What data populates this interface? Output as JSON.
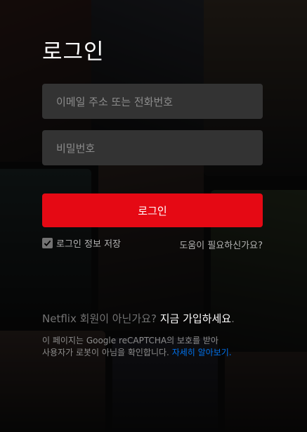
{
  "title": "로그인",
  "email_placeholder": "이메일 주소 또는 전화번호",
  "password_placeholder": "비밀번호",
  "login_button": "로그인",
  "remember_label": "로그인 정보 저장",
  "help_link": "도움이 필요하신가요?",
  "signup_prefix": "Netflix 회원이 아닌가요?",
  "signup_link": "지금 가입하세요",
  "signup_suffix": ".",
  "captcha_line1": "이 페이지는 Google reCAPTCHA의 보호를 받아",
  "captcha_line2": "사용자가 로봇이 아님을 확인합니다.",
  "captcha_link": "자세히 알아보기.",
  "colors": {
    "accent": "#e50914",
    "field_bg": "#333333",
    "link": "#0071eb"
  }
}
